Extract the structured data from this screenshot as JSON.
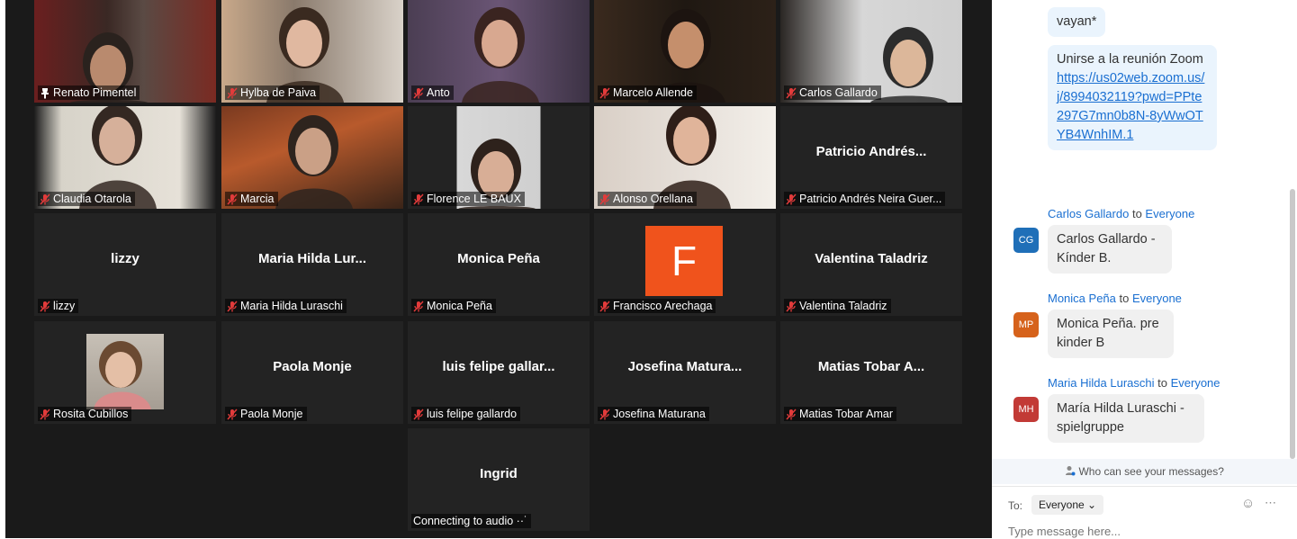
{
  "gallery": {
    "tiles": [
      {
        "name": "Renato Pimentel",
        "label": "Renato Pimentel",
        "pinned": true
      },
      {
        "name": "Hylba de Paiva",
        "label": "Hylba de Paiva"
      },
      {
        "name": "Anto",
        "label": "Anto"
      },
      {
        "name": "Marcelo Allende",
        "label": "Marcelo Allende"
      },
      {
        "name": "Carlos Gallardo",
        "label": "Carlos Gallardo"
      },
      {
        "name": "Claudia Otarola",
        "label": "Claudia Otarola"
      },
      {
        "name": "Marcia",
        "label": "Marcia"
      },
      {
        "name": "Florence LE BAUX",
        "label": "Florence LE BAUX"
      },
      {
        "name": "Alonso Orellana",
        "label": "Alonso Orellana"
      },
      {
        "center": "Patricio Andrés...",
        "label": "Patricio Andrés Neira Guer..."
      },
      {
        "center": "lizzy",
        "label": "lizzy"
      },
      {
        "center": "Maria Hilda Lur...",
        "label": "Maria Hilda Luraschi"
      },
      {
        "center": "Monica Peña",
        "label": "Monica Peña"
      },
      {
        "avatar": "F",
        "label": "Francisco Arechaga"
      },
      {
        "center": "Valentina Taladriz",
        "label": "Valentina Taladriz"
      },
      {
        "label": "Rosita Cubillos"
      },
      {
        "center": "Paola Monje",
        "label": "Paola Monje"
      },
      {
        "center": "luis felipe gallar...",
        "label": "luis felipe gallardo"
      },
      {
        "center": "Josefina Matura...",
        "label": "Josefina Maturana"
      },
      {
        "center": "Matias Tobar A...",
        "label": "Matias Tobar Amar"
      },
      {
        "center": "Ingrid",
        "label": "Connecting to audio ··˙"
      }
    ]
  },
  "chat": {
    "messages": {
      "m0": {
        "text": "vayan*"
      },
      "m1": {
        "text": "Unirse a la reunión Zoom",
        "link": "https://us02web.zoom.us/j/8994032119?pwd=PPte297G7mn0b8N-8yWwOTYB4WnhIM.1"
      },
      "m2": {
        "sender": "Carlos Gallardo",
        "to": "to",
        "recipient": "Everyone",
        "initials": "CG",
        "color": "#1f6fb8",
        "text": "Carlos Gallardo - Kínder B."
      },
      "m3": {
        "sender": "Monica Peña",
        "to": "to",
        "recipient": "Everyone",
        "initials": "MP",
        "color": "#d6621b",
        "text": "Monica Peña. pre kinder B"
      },
      "m4": {
        "sender": "Maria Hilda Luraschi",
        "to": "to",
        "recipient": "Everyone",
        "initials": "MH",
        "color": "#c23a36",
        "text": "María Hilda Luraschi - spielgruppe"
      }
    },
    "visibility_text": "Who can see your messages?",
    "to_label": "To:",
    "to_value": "Everyone",
    "placeholder": "Type message here...",
    "accent": "#1a6fd1"
  }
}
